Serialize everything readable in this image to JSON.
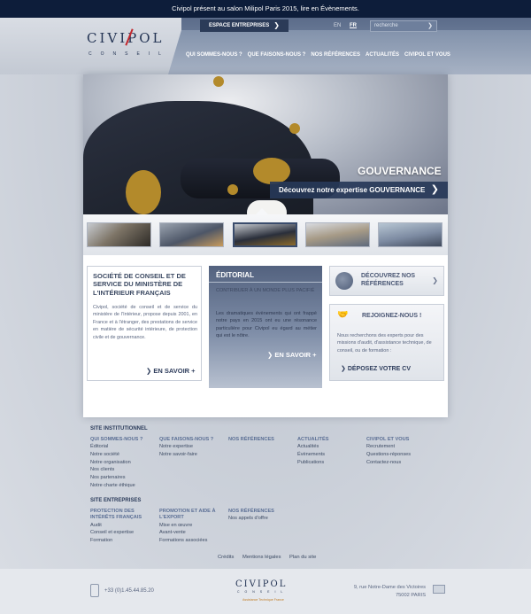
{
  "topbar": {
    "text": "Civipol présent au salon Milipol Paris 2015, lire en Évènements."
  },
  "logo": {
    "name": "CIVIPOL",
    "subtitle": "CONSEIL"
  },
  "header": {
    "espace_label": "ESPACE ENTREPRISES",
    "lang_en": "EN",
    "lang_fr": "FR",
    "search_placeholder": "recherche",
    "nav": [
      "QUI SOMMES-NOUS ?",
      "QUE FAISONS-NOUS ?",
      "NOS RÉFÉRENCES",
      "ACTUALITÉS",
      "CIVIPOL ET VOUS"
    ]
  },
  "hero": {
    "title": "GOUVERNANCE",
    "cta": "Découvrez notre expertise GOUVERNANCE"
  },
  "thumbnails": [
    "thumb-1",
    "thumb-2",
    "thumb-3",
    "thumb-4",
    "thumb-5"
  ],
  "societe": {
    "title": "SOCIÉTÉ DE CONSEIL ET DE SERVICE DU MINISTÈRE DE L'INTÉRIEUR FRANÇAIS",
    "text": "Civipol, société de conseil et de service du ministère de l'Intérieur, propose depuis 2001, en France et à l'étranger, des prestations de service en matière de sécurité intérieure, de protection civile et de gouvernance.",
    "more": "EN SAVOIR +"
  },
  "editorial": {
    "title": "ÉDITORIAL",
    "quote": "CONTRIBUER À UN MONDE PLUS PACIFIÉ",
    "text": "Les dramatiques évènements qui ont frappé notre pays en 2015 ont eu une résonance particulière pour Civipol eu égard au métier qui est le nôtre.",
    "more": "EN SAVOIR +"
  },
  "references": {
    "label": "DÉCOUVREZ NOS RÉFÉRENCES"
  },
  "join": {
    "title": "REJOIGNEZ-NOUS !",
    "text": "Nous recherchons des experts pour des missions d'audit, d'assistance technique, de conseil, ou de formation :",
    "cta": "DÉPOSEZ VOTRE CV"
  },
  "sitemap": {
    "institutionnel_label": "SITE INSTITUTIONNEL",
    "col1": {
      "heading": "QUI SOMMES-NOUS ?",
      "links": [
        "Éditorial",
        "Notre société",
        "Notre organisation",
        "Nos clients",
        "Nos partenaires",
        "Notre charte éthique"
      ]
    },
    "col2": {
      "heading": "QUE FAISONS-NOUS ?",
      "links": [
        "Notre expertise",
        "Notre savoir-faire"
      ]
    },
    "col3": {
      "heading": "NOS RÉFÉRENCES",
      "links": []
    },
    "col4": {
      "heading": "ACTUALITÉS",
      "links": [
        "Actualités",
        "Évènements",
        "Publications"
      ]
    },
    "col5": {
      "heading": "CIVIPOL ET VOUS",
      "links": [
        "Recrutement",
        "Questions-réponses",
        "Contactez-nous"
      ]
    },
    "entreprises_label": "SITE ENTREPRISES",
    "ent1": {
      "heading": "PROTECTION DES INTÉRÊTS FRANÇAIS",
      "links": [
        "Audit",
        "Conseil et expertise",
        "Formation"
      ]
    },
    "ent2": {
      "heading": "PROMOTION ET AIDE À L'EXPORT",
      "links": [
        "Mise en œuvre",
        "Avant-vente",
        "Formations associées"
      ]
    },
    "ent3": {
      "heading": "NOS RÉFÉRENCES",
      "links": [
        "Nos appels d'offre"
      ]
    }
  },
  "legal": {
    "credits": "Crédits",
    "mentions": "Mentions légales",
    "plan": "Plan du site"
  },
  "footer": {
    "phone": "+33 (0)1.45.44.85.20",
    "logo_name": "CIVIPOL",
    "logo_sub": "CONSEIL",
    "logo_tag": "Assistance Technique France",
    "address_line1": "9, rue Notre-Dame des Victoires",
    "address_line2": "75002 PARIS"
  }
}
